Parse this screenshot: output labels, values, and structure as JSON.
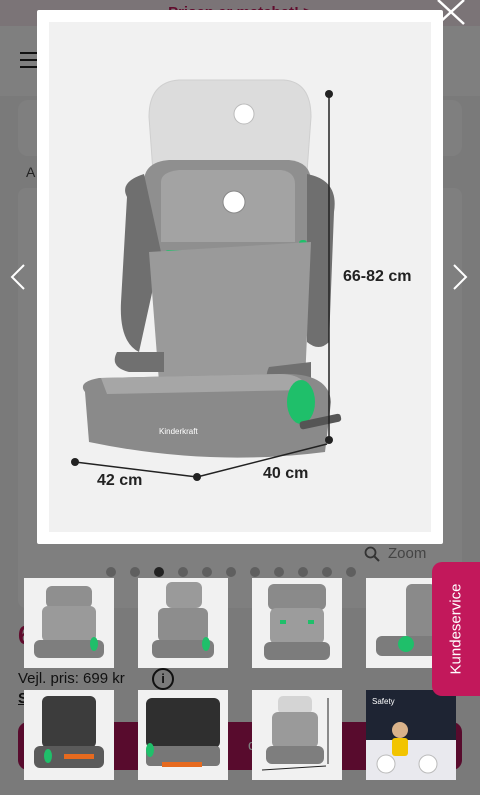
{
  "background": {
    "promo_text": "Prisen er matchet! >",
    "breadcrumb": "A",
    "price_partial": "6",
    "list_price": "Vejl. pris: 699 kr",
    "link_partial": "S                    k",
    "info_icon_text": "i",
    "buy_button_partial": "dkøb"
  },
  "lightbox": {
    "dimensions": {
      "height": "66-82 cm",
      "width": "42 cm",
      "depth": "40 cm"
    },
    "brand_on_seat": "Kinderkraft",
    "zoom_label": "Zoom",
    "dots_total": 11,
    "active_dot": 2,
    "thumbnails": [
      {
        "id": "front-view"
      },
      {
        "id": "headrest-raised-view"
      },
      {
        "id": "front-straight-view"
      },
      {
        "id": "side-view"
      },
      {
        "id": "back-view"
      },
      {
        "id": "base-isofix-view"
      },
      {
        "id": "dimensions-view"
      },
      {
        "id": "safety-in-car-view"
      }
    ],
    "safety_thumb_text": "Safety"
  },
  "support": {
    "label": "Kundeservice"
  },
  "colors": {
    "accent": "#c2185b",
    "seat_gray": "#8a8a8a",
    "isofix_green": "#1fbf6a"
  }
}
